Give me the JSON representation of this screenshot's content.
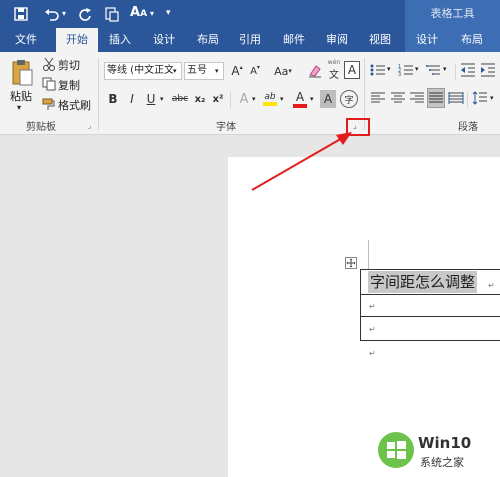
{
  "qat": {
    "save_icon": "save-icon",
    "undo_icon": "undo-icon",
    "redo_icon": "redo-icon",
    "customize": "▾"
  },
  "context_header": "表格工具",
  "tabs": [
    {
      "label": "文件"
    },
    {
      "label": "开始"
    },
    {
      "label": "插入"
    },
    {
      "label": "设计"
    },
    {
      "label": "布局"
    },
    {
      "label": "引用"
    },
    {
      "label": "邮件"
    },
    {
      "label": "审阅"
    },
    {
      "label": "视图"
    },
    {
      "label": "设计"
    },
    {
      "label": "布局"
    }
  ],
  "clipboard": {
    "paste": "粘贴",
    "cut": "剪切",
    "copy": "复制",
    "format_painter": "格式刷",
    "group": "剪贴板"
  },
  "font": {
    "name": "等线 (中文正文)",
    "size": "五号",
    "bold": "B",
    "italic": "I",
    "underline": "U",
    "strike": "abc",
    "sub": "x₂",
    "sup": "x²",
    "change_case": "Aa",
    "grow": "A",
    "shrink": "A",
    "phonetic": "文",
    "border_char": "A",
    "effect": "A",
    "highlight": "ab",
    "color": "A",
    "shade": "A",
    "encircle": "字",
    "group": "字体"
  },
  "paragraph": {
    "group": "段落"
  },
  "document": {
    "cell_text": "字间距怎么调整",
    "para_mark": "↵"
  },
  "colors": {
    "accent": "#2b579a",
    "highlight": "#ffe600",
    "font_color": "#e21b1b",
    "annotation": "#e21b1b"
  },
  "watermark": {
    "text": "Win10",
    "subtitle": "系统之家"
  }
}
